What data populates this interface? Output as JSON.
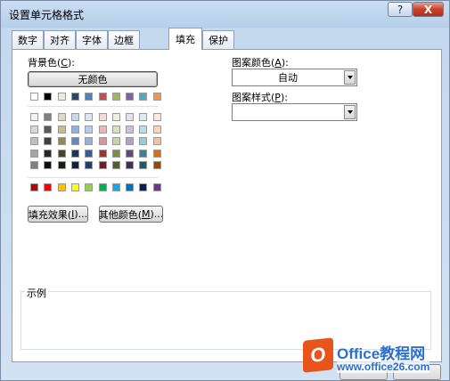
{
  "window": {
    "title": "设置单元格格式",
    "help_label": "?",
    "close_label": "X"
  },
  "tabs": [
    {
      "label": "数字"
    },
    {
      "label": "对齐"
    },
    {
      "label": "字体"
    },
    {
      "label": "边框"
    },
    {
      "label": "填充",
      "active": true
    },
    {
      "label": "保护"
    }
  ],
  "fill": {
    "background_label": "背景色(",
    "background_key": "C",
    "background_tail": "):",
    "no_color_label": "无颜色",
    "fill_effects_label": "填充效果(",
    "fill_effects_key": "I",
    "fill_effects_tail": ")...",
    "more_colors_label": "其他颜色(",
    "more_colors_key": "M",
    "more_colors_tail": ")...",
    "pattern_color_label": "图案颜色(",
    "pattern_color_key": "A",
    "pattern_color_tail": "):",
    "pattern_color_value": "自动",
    "pattern_style_label": "图案样式(",
    "pattern_style_key": "P",
    "pattern_style_tail": "):",
    "pattern_style_value": "",
    "sample_label": "示例"
  },
  "palette": {
    "theme_row": [
      "#ffffff",
      "#000000",
      "#eeece1",
      "#1f497d",
      "#4f81bd",
      "#c0504d",
      "#9bbb59",
      "#8064a2",
      "#4bacc6",
      "#f79646"
    ],
    "tint_rows": [
      [
        "#f2f2f2",
        "#7f7f7f",
        "#ddd9c3",
        "#c6d9f0",
        "#dbe5f1",
        "#f2dcdb",
        "#ebf1dd",
        "#e5e0ec",
        "#dbeef3",
        "#fdeada"
      ],
      [
        "#d8d8d8",
        "#595959",
        "#c4bd97",
        "#8db3e2",
        "#b8cce4",
        "#e5b9b7",
        "#d7e3bc",
        "#ccc1d9",
        "#b7dde8",
        "#fbd5b5"
      ],
      [
        "#bfbfbf",
        "#3f3f3f",
        "#938953",
        "#548dd4",
        "#95b3d7",
        "#d99694",
        "#c3d69b",
        "#b2a2c7",
        "#92cddc",
        "#fac08f"
      ],
      [
        "#a5a5a5",
        "#262626",
        "#494429",
        "#17365d",
        "#366092",
        "#953734",
        "#76923c",
        "#5f497a",
        "#31859b",
        "#e36c09"
      ],
      [
        "#7f7f7f",
        "#0c0c0c",
        "#1d1b10",
        "#0f243e",
        "#244061",
        "#632423",
        "#4f6128",
        "#3f3151",
        "#205867",
        "#974806"
      ]
    ],
    "standard_row": [
      "#c00000",
      "#ff0000",
      "#ffc000",
      "#ffff00",
      "#92d050",
      "#00b050",
      "#00b0f0",
      "#0070c0",
      "#002060",
      "#7030a0"
    ]
  },
  "watermark": {
    "logo_glyph": "O",
    "title": "Office教程网",
    "subtitle": "www.office26.com"
  }
}
